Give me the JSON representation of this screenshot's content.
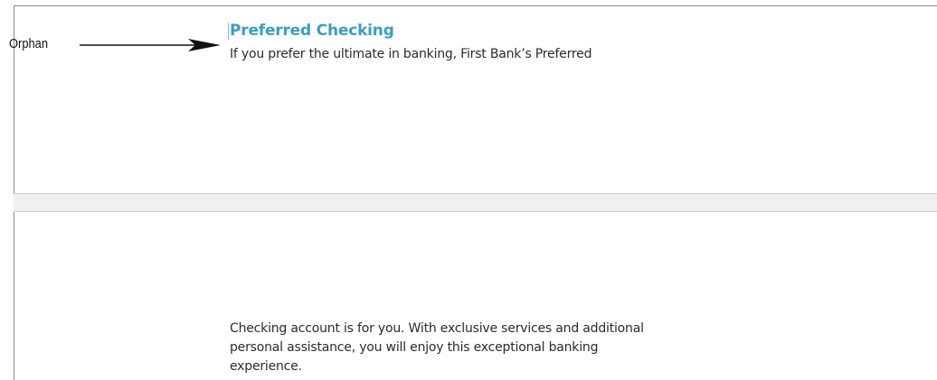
{
  "callout": {
    "label": "Orphan"
  },
  "document": {
    "heading": "Preferred Checking",
    "orphan_line": "If you prefer the ultimate in banking, First Bank’s Preferred",
    "continued_lines": [
      "Checking account is for you. With exclusive services and additional",
      "personal assistance, you will enjoy this exceptional banking",
      "experience."
    ]
  },
  "colors": {
    "heading": "#3a9ec0",
    "body_text": "#2b2b2b",
    "page_gap": "#f0f0f0"
  }
}
